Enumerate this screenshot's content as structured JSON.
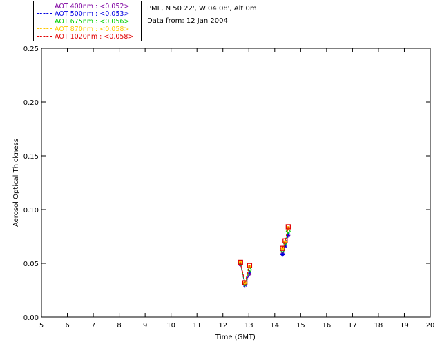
{
  "header": {
    "location": "PML, N 50 22', W 04 08', Alt 0m",
    "date_line": "Data from: 12 Jan 2004"
  },
  "legend": [
    {
      "label": "AOT  400nm : <0.052>",
      "color": "#7f00a0"
    },
    {
      "label": "AOT  500nm : <0.053>",
      "color": "#0000e0"
    },
    {
      "label": "AOT  675nm : <0.056>",
      "color": "#00d000"
    },
    {
      "label": "AOT  870nm : <0.058>",
      "color": "#ffc800"
    },
    {
      "label": "AOT 1020nm : <0.058>",
      "color": "#e00000"
    }
  ],
  "chart_data": {
    "type": "line",
    "xlabel": "Time (GMT)",
    "ylabel": "Aerosol Optical Thickness",
    "xlim": [
      5,
      20
    ],
    "ylim": [
      0.0,
      0.25
    ],
    "xticks": [
      "5",
      "6",
      "7",
      "8",
      "9",
      "10",
      "11",
      "12",
      "13",
      "14",
      "15",
      "16",
      "17",
      "18",
      "19",
      "20"
    ],
    "yticks": [
      "0.00",
      "0.05",
      "0.10",
      "0.15",
      "0.20",
      "0.25"
    ],
    "grid": false,
    "segments": [
      {
        "x": [
          12.68,
          12.85,
          13.03
        ]
      },
      {
        "x": [
          14.3,
          14.4,
          14.52
        ]
      }
    ],
    "series": [
      {
        "name": "AOT  400nm : <0.052>",
        "color": "#7f00a0",
        "marker": "star",
        "values": [
          [
            0.049,
            0.03,
            0.04
          ],
          [
            0.059,
            0.067,
            0.076
          ]
        ]
      },
      {
        "name": "AOT  500nm : <0.053>",
        "color": "#0000e0",
        "marker": "star",
        "values": [
          [
            0.05,
            0.03,
            0.042
          ],
          [
            0.058,
            0.066,
            0.077
          ]
        ]
      },
      {
        "name": "AOT  675nm : <0.056>",
        "color": "#00d000",
        "marker": "diamond",
        "values": [
          [
            0.05,
            0.031,
            0.044
          ],
          [
            0.062,
            0.069,
            0.08
          ]
        ]
      },
      {
        "name": "AOT  870nm : <0.058>",
        "color": "#ffc800",
        "marker": "circle",
        "values": [
          [
            0.051,
            0.032,
            0.047
          ],
          [
            0.064,
            0.07,
            0.083
          ]
        ]
      },
      {
        "name": "AOT 1020nm : <0.058>",
        "color": "#e00000",
        "marker": "square",
        "values": [
          [
            0.051,
            0.032,
            0.048
          ],
          [
            0.064,
            0.071,
            0.084
          ]
        ]
      }
    ]
  }
}
